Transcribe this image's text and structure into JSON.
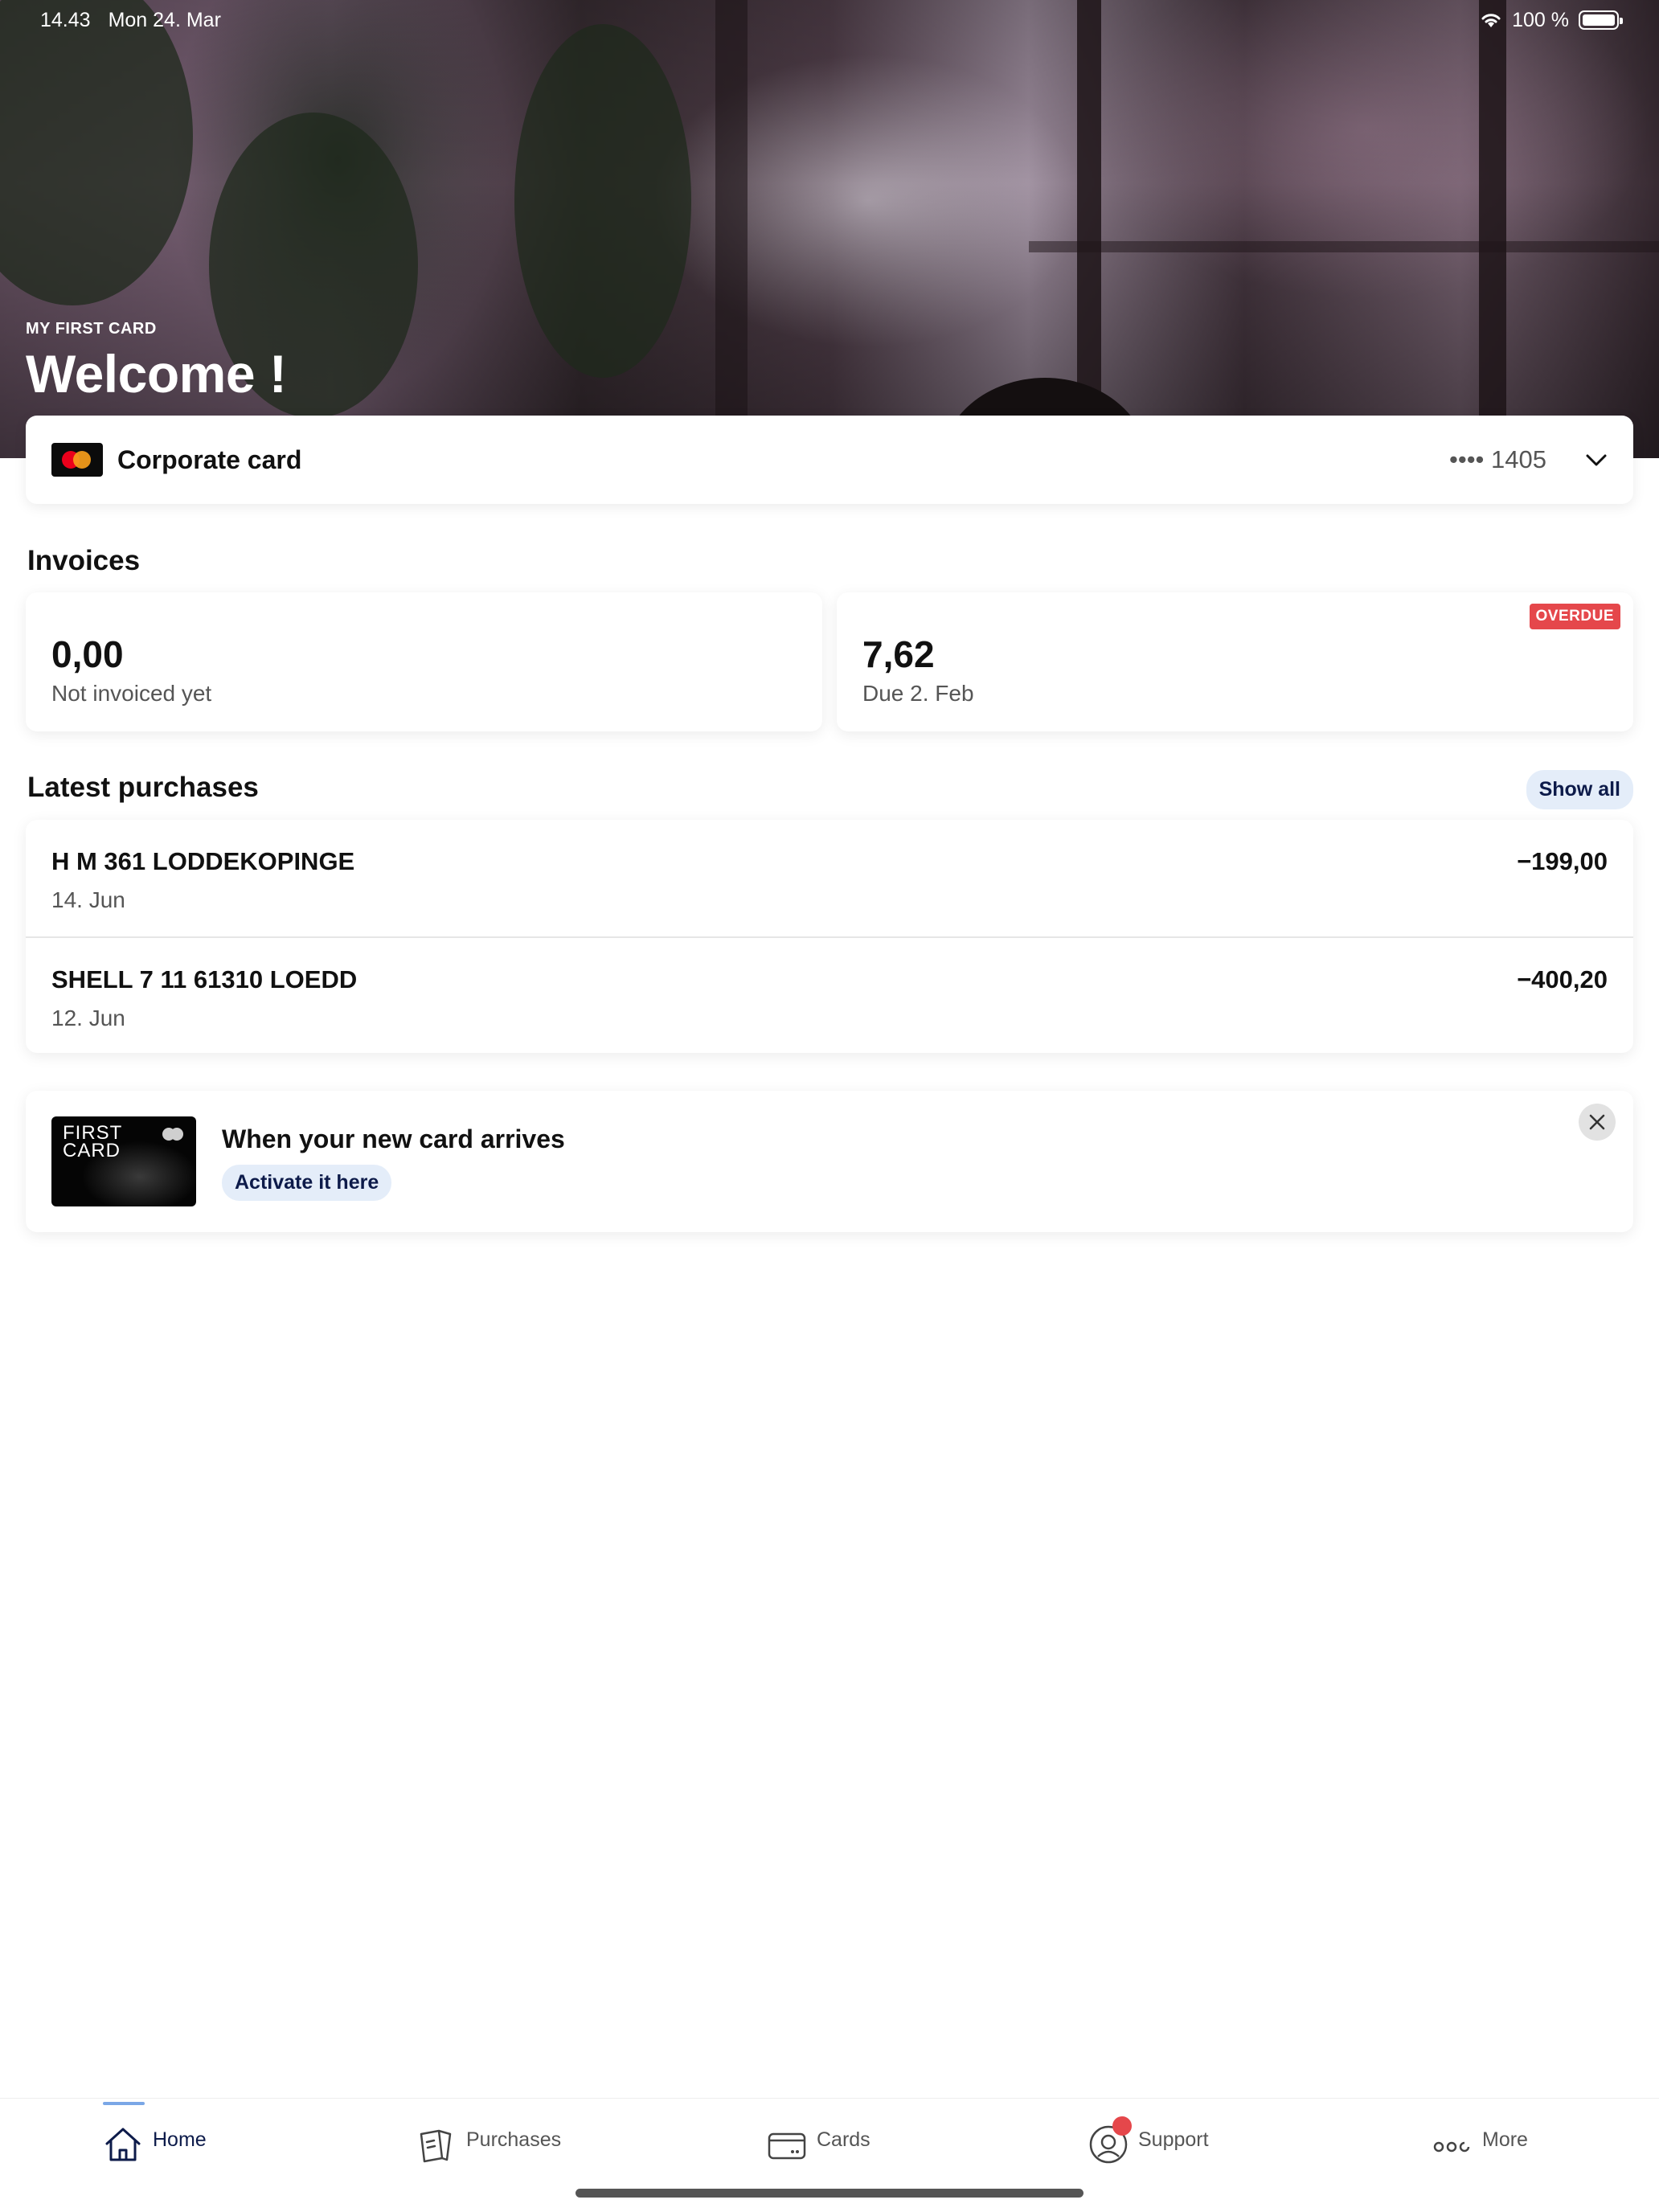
{
  "status_bar": {
    "time": "14.43",
    "date": "Mon 24. Mar",
    "battery": "100 %"
  },
  "hero": {
    "kicker": "MY FIRST CARD",
    "title": "Welcome !"
  },
  "card_selector": {
    "name": "Corporate card",
    "number": "•••• 1405",
    "icon": "chevron-down-icon"
  },
  "invoices": {
    "title": "Invoices",
    "items": [
      {
        "amount": "0,00",
        "subtitle": "Not invoiced yet"
      },
      {
        "amount": "7,62",
        "subtitle": "Due 2. Feb",
        "badge": "OVERDUE"
      }
    ]
  },
  "purchases": {
    "title": "Latest purchases",
    "show_all": "Show all",
    "items": [
      {
        "merchant": "H M 361 LODDEKOPINGE",
        "date": "14. Jun",
        "amount": "−199,00"
      },
      {
        "merchant": "SHELL 7 11 61310 LOEDD",
        "date": "12. Jun",
        "amount": "−400,20"
      }
    ]
  },
  "promo": {
    "card_brand_line1": "FIRST",
    "card_brand_line2": "CARD",
    "title": "When your new card arrives",
    "action": "Activate it here"
  },
  "tabbar": {
    "tabs": [
      {
        "label": "Home",
        "icon": "home-icon",
        "active": true
      },
      {
        "label": "Purchases",
        "icon": "receipt-icon"
      },
      {
        "label": "Cards",
        "icon": "card-icon"
      },
      {
        "label": "Support",
        "icon": "support-icon"
      },
      {
        "label": "More",
        "icon": "more-icon"
      }
    ]
  },
  "colors": {
    "accent": "#0d1b4a",
    "overdue": "#e5474b",
    "pill_bg": "#e4edf9"
  }
}
